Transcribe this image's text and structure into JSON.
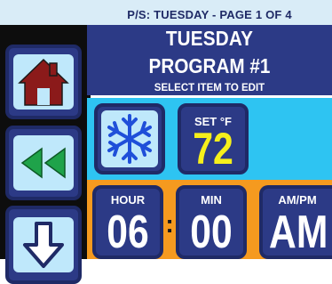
{
  "top_bar": {
    "title": "P/S: TUESDAY - PAGE 1 OF 4"
  },
  "header": {
    "day": "TUESDAY",
    "program": "PROGRAM #1",
    "hint": "SELECT ITEM TO EDIT"
  },
  "nav": {
    "home_icon": "home-icon",
    "back_icon": "rewind-icon",
    "down_icon": "down-arrow-icon"
  },
  "mode": {
    "icon": "snowflake-icon"
  },
  "setpoint": {
    "label": "SET °F",
    "value": "72"
  },
  "time": {
    "hour_label": "HOUR",
    "hour_value": "06",
    "separator": ":",
    "minute_label": "MIN",
    "minute_value": "00",
    "ampm_label": "AM/PM",
    "ampm_value": "AM"
  },
  "colors": {
    "navy": "#2c3a86",
    "light_blue": "#bfe8fb",
    "cyan": "#2ec4f2",
    "orange": "#f59a1f",
    "yellow": "#f6ef1b",
    "house_red": "#8b1a1a",
    "green": "#1fa34a"
  }
}
